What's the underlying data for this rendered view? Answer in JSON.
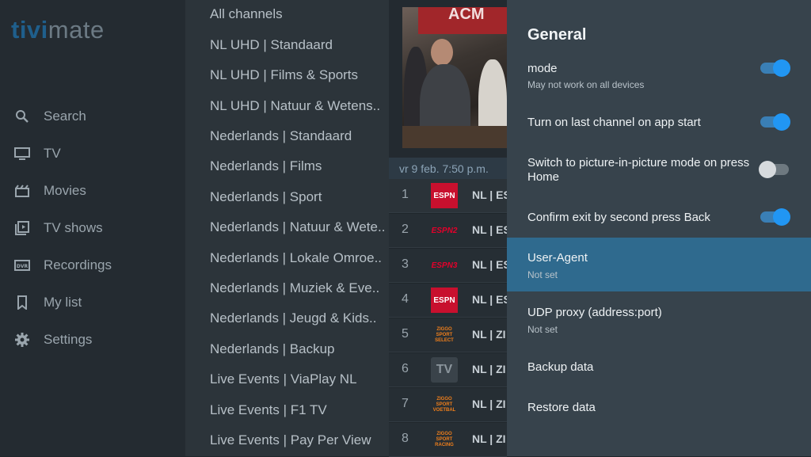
{
  "logo": {
    "part1": "tivi",
    "part2": "mate"
  },
  "nav": [
    {
      "label": "Search",
      "icon": "search-icon"
    },
    {
      "label": "TV",
      "icon": "tv-icon"
    },
    {
      "label": "Movies",
      "icon": "movie-icon"
    },
    {
      "label": "TV shows",
      "icon": "tv-shows-icon"
    },
    {
      "label": "Recordings",
      "icon": "dvr-icon"
    },
    {
      "label": "My list",
      "icon": "bookmark-icon"
    },
    {
      "label": "Settings",
      "icon": "gear-icon"
    }
  ],
  "groups": [
    "All channels",
    "NL UHD | Standaard",
    "NL UHD | Films & Sports",
    "NL UHD | Natuur & Wetens..",
    "Nederlands | Standaard",
    "Nederlands | Films",
    "Nederlands | Sport",
    "Nederlands | Natuur & Wete..",
    "Nederlands | Lokale Omroe..",
    "Nederlands | Muziek & Eve..",
    "Nederlands | Jeugd & Kids..",
    "Nederlands | Backup",
    "Live Events | ViaPlay NL",
    "Live Events | F1 TV",
    "Live Events | Pay Per View"
  ],
  "preview": {
    "banner_text": "ACM"
  },
  "epg_date": "vr 9 feb. 7:50 p.m.",
  "channels": [
    {
      "num": "1",
      "logo": "ESPN",
      "name": "NL | ES"
    },
    {
      "num": "2",
      "logo": "ESPN2",
      "name": "NL | ES"
    },
    {
      "num": "3",
      "logo": "ESPN3",
      "name": "NL | ES"
    },
    {
      "num": "4",
      "logo": "ESPN",
      "name": "NL | ES"
    },
    {
      "num": "5",
      "logo": "ZIGGO SPORT SELECT",
      "name": "NL | ZI"
    },
    {
      "num": "6",
      "logo": "TV",
      "name": "NL | ZI"
    },
    {
      "num": "7",
      "logo": "ZIGGO SPORT VOETBAL",
      "name": "NL | ZI"
    },
    {
      "num": "8",
      "logo": "ZIGGO SPORT RACING",
      "name": "NL | ZI"
    }
  ],
  "panel": {
    "title": "General",
    "settings": [
      {
        "title": "mode",
        "subtitle": "May not work on all devices",
        "toggle": "on"
      },
      {
        "title": "Turn on last channel on app start",
        "toggle": "on"
      },
      {
        "title": "Switch to picture-in-picture mode on press Home",
        "toggle": "off"
      },
      {
        "title": "Confirm exit by second press Back",
        "toggle": "on"
      },
      {
        "title": "User-Agent",
        "subtitle": "Not set",
        "focused": true
      },
      {
        "title": "UDP proxy (address:port)",
        "subtitle": "Not set"
      },
      {
        "title": "Backup data"
      },
      {
        "title": "Restore data"
      }
    ]
  },
  "colors": {
    "accent": "#2196f3",
    "focus": "#2f6a8e",
    "panel": "#37434c",
    "espn_red": "#c8102e",
    "ziggo_orange": "#f07f1b"
  }
}
